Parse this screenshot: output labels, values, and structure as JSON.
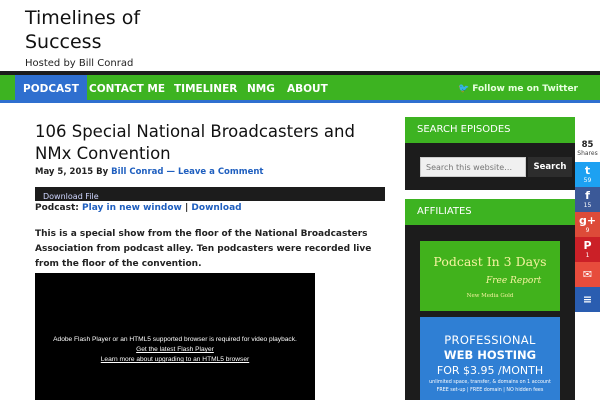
{
  "site": {
    "title": "Timelines of Success",
    "description": "Hosted by Bill Conrad"
  },
  "nav": {
    "items": [
      {
        "label": "PODCAST",
        "active": true
      },
      {
        "label": "CONTACT ME"
      },
      {
        "label": "TIMELINER"
      },
      {
        "label": "NMG"
      },
      {
        "label": "ABOUT"
      }
    ],
    "twitter_label": "Follow me on Twitter"
  },
  "post": {
    "title": "106 Special National Broadcasters and NMx Convention",
    "date": "May 5, 2015",
    "by": "By",
    "author": "Bill Conrad",
    "separator": "—",
    "comment_link": "Leave a Comment",
    "audio_label": "Download File",
    "podcast_label": "Podcast:",
    "play_link": "Play in new window",
    "pipe": "|",
    "download_link": "Download",
    "body": "This is a special show from the floor of the National Broadcasters Association from podcast alley. Ten podcasters were recorded live from the floor of the convention.",
    "video": {
      "line1": "Adobe Flash Player or an HTML5 supported browser is required for video playback.",
      "line2": "Get the latest Flash Player",
      "line3": "Learn more about upgrading to an HTML5 browser"
    }
  },
  "sidebar": {
    "search_heading": "SEARCH EPISODES",
    "search_placeholder": "Search this website…",
    "search_button": "Search",
    "affiliates_heading": "AFFILIATES",
    "banner1": {
      "title": "Podcast In 3 Days",
      "tagline": "Free Report",
      "brand": "New Media Gold"
    },
    "banner2": {
      "line1": "PROFESSIONAL",
      "line2": "WEB HOSTING",
      "line3": "FOR $3.95 /MONTH",
      "line4": "unlimited space, transfer, & domains on 1 account",
      "line5": "FREE set-up | FREE domain | NO hidden fees"
    }
  },
  "share": {
    "total": "85",
    "total_label": "Shares",
    "buttons": [
      {
        "network": "twitter",
        "count": "59",
        "color": "#1da1f2",
        "glyph": "t"
      },
      {
        "network": "facebook",
        "count": "15",
        "color": "#3b5998",
        "glyph": "f"
      },
      {
        "network": "google-plus",
        "count": "9",
        "color": "#dd4b39",
        "glyph": "g+"
      },
      {
        "network": "pinterest",
        "count": "1",
        "color": "#cb2027",
        "glyph": "P"
      },
      {
        "network": "email",
        "count": "",
        "color": "#e74c3c",
        "glyph": "✉"
      },
      {
        "network": "buffer",
        "count": "",
        "color": "#2a5db0",
        "glyph": "≡"
      }
    ]
  },
  "colors": {
    "brand_green": "#3db321",
    "accent_blue": "#2f6fcf",
    "dark": "#1c1c1c"
  }
}
